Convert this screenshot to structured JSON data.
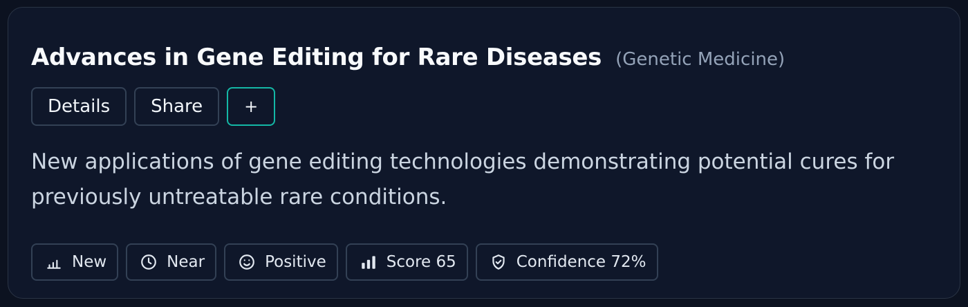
{
  "card": {
    "title": "Advances in Gene Editing for Rare Diseases",
    "category": "(Genetic Medicine)",
    "description": "New applications of gene editing technologies demonstrating potential cures for previously untreatable rare conditions."
  },
  "actions": {
    "details_label": "Details",
    "share_label": "Share",
    "add_label": "+"
  },
  "badges": [
    {
      "icon": "bar-chart-low-icon",
      "label": "New"
    },
    {
      "icon": "clock-icon",
      "label": "Near"
    },
    {
      "icon": "smile-icon",
      "label": "Positive"
    },
    {
      "icon": "bar-chart-icon",
      "label": "Score 65"
    },
    {
      "icon": "shield-check-icon",
      "label": "Confidence 72%"
    }
  ],
  "colors": {
    "background": "#0c1220",
    "card": "#0f172a",
    "border": "#334155",
    "accent": "#14b8a6",
    "title": "#f8fafc",
    "muted": "#94a3b8"
  }
}
